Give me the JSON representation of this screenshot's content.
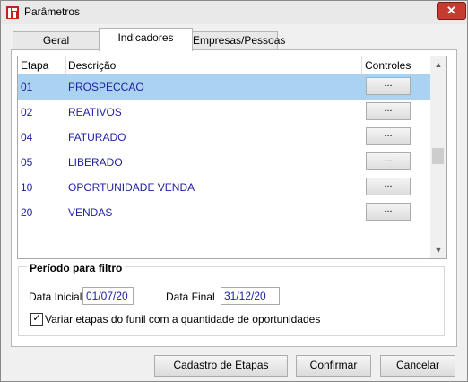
{
  "window": {
    "title": "Parâmetros",
    "close_glyph": "✕"
  },
  "tabs": [
    {
      "label": "Geral"
    },
    {
      "label": "Indicadores"
    },
    {
      "label": "Empresas/Pessoas"
    }
  ],
  "grid": {
    "headers": {
      "etapa": "Etapa",
      "descricao": "Descrição",
      "controles": "Controles"
    },
    "rows": [
      {
        "etapa": "01",
        "descricao": "PROSPECCAO",
        "btn": "...",
        "selected": true
      },
      {
        "etapa": "02",
        "descricao": "REATIVOS",
        "btn": "..."
      },
      {
        "etapa": "04",
        "descricao": "FATURADO",
        "btn": "..."
      },
      {
        "etapa": "05",
        "descricao": "LIBERADO",
        "btn": "..."
      },
      {
        "etapa": "10",
        "descricao": "OPORTUNIDADE VENDA",
        "btn": "..."
      },
      {
        "etapa": "20",
        "descricao": "VENDAS",
        "btn": "..."
      }
    ],
    "scroll_up": "▲",
    "scroll_down": "▼"
  },
  "period": {
    "legend": "Período para filtro",
    "start_label": "Data Inicial",
    "start_value": "01/07/20",
    "end_label": "Data Final",
    "end_value": "31/12/20",
    "checkbox_label": "Variar etapas do funil com a quantidade de oportunidades",
    "checkbox_checked": true,
    "check_glyph": "✓"
  },
  "buttons": {
    "stages": "Cadastro de Etapas",
    "confirm": "Confirmar",
    "cancel": "Cancelar"
  }
}
